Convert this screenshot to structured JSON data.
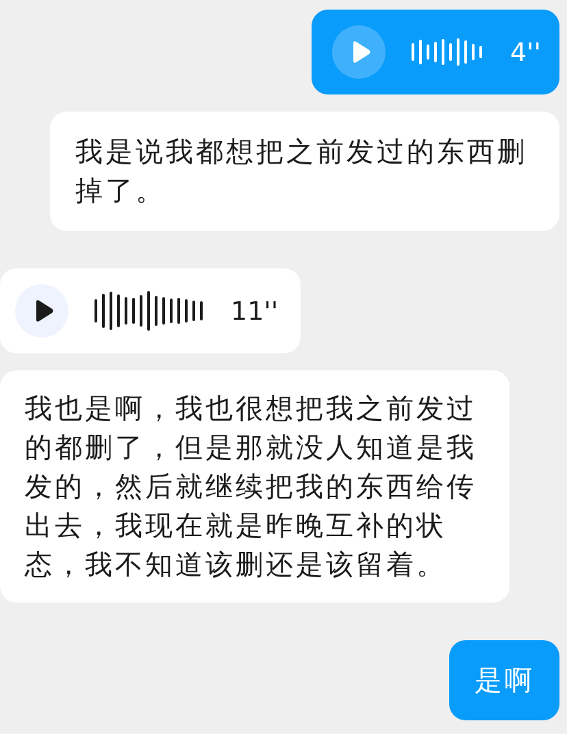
{
  "messages": [
    {
      "kind": "voice",
      "outgoing": true,
      "color": "#0a9cfb",
      "duration": "4''"
    },
    {
      "kind": "text",
      "outgoing": true,
      "color": "#ffffff",
      "text": "我是说我都想把之前发过的东西删掉了。"
    },
    {
      "kind": "voice",
      "outgoing": false,
      "color": "#ffffff",
      "duration": "11''"
    },
    {
      "kind": "text",
      "outgoing": false,
      "color": "#ffffff",
      "text": "我也是啊，我也很想把我之前发过的都删了，但是那就没人知道是我发的，然后就继续把我的东西给传出去，我现在就是昨晚互补的状态，我不知道该删还是该留着。"
    },
    {
      "kind": "text",
      "outgoing": true,
      "color": "#0a9cfb",
      "text": "是啊"
    }
  ]
}
